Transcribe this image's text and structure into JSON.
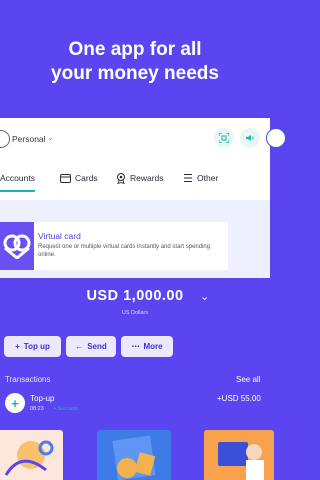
{
  "headline": {
    "line1": "One app for all",
    "line2": "your money needs"
  },
  "account": {
    "name": "Personal",
    "chevron_icon": "chevron-down-icon"
  },
  "top_actions": [
    {
      "icon": "scan-icon"
    },
    {
      "icon": "sound-icon"
    },
    {
      "icon": "help-icon"
    }
  ],
  "tabs": [
    {
      "label": "Accounts",
      "icon": "accounts-icon",
      "active": true
    },
    {
      "label": "Cards",
      "icon": "card-icon",
      "active": false
    },
    {
      "label": "Rewards",
      "icon": "rewards-icon",
      "active": false
    },
    {
      "label": "Other",
      "icon": "menu-icon",
      "active": false
    }
  ],
  "virtual_card": {
    "title": "Virtual card",
    "description": "Request one or multiple virtual cards instantly and start spending online."
  },
  "balance": {
    "amount": "USD 1,000.00",
    "currency_name": "US Dollars"
  },
  "actions": {
    "topup": "Top up",
    "send": "Send",
    "more": "More"
  },
  "transactions": {
    "header": "Transactions",
    "see_all": "See all",
    "items": [
      {
        "title": "Top-up",
        "time": "08:23",
        "status": "• Success",
        "amount": "+USD 55.00"
      }
    ]
  },
  "colors": {
    "background": "#5b45f0",
    "accent": "#1db8a5",
    "button_bg": "#ece9ff"
  }
}
